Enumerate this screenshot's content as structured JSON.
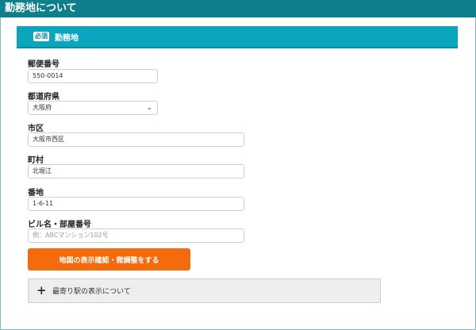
{
  "header": {
    "title": "勤務地について"
  },
  "section": {
    "badge": "必須",
    "title": "勤務地"
  },
  "fields": {
    "postal": {
      "label": "郵便番号",
      "value": "550-0014"
    },
    "prefecture": {
      "label": "都道府県",
      "value": "大阪府"
    },
    "city": {
      "label": "市区",
      "value": "大阪市西区"
    },
    "town": {
      "label": "町村",
      "value": "北堀江"
    },
    "address": {
      "label": "番地",
      "value": "1-6-11"
    },
    "building": {
      "label": "ビル名・部屋番号",
      "placeholder": "例：ABCマンション102号"
    }
  },
  "buttons": {
    "map_confirm": "地図の表示確認・微調整をする"
  },
  "accordion": {
    "label": "最寄り駅の表示について"
  },
  "icons": {
    "select": "chevron-down-icon",
    "expand": "plus-icon"
  },
  "colors": {
    "header_bg": "#0f7f8c",
    "section_bg": "#0aa6bd",
    "button_bg": "#f36b0c",
    "accordion_bg": "#eeeeee"
  }
}
